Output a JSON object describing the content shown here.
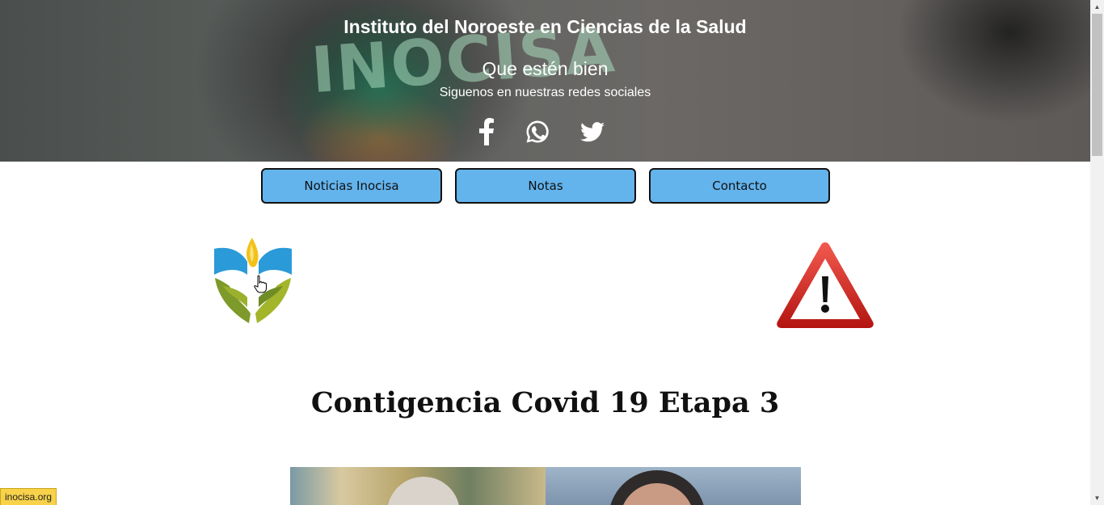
{
  "hero": {
    "title": "Instituto del Noroeste en Ciencias de la Salud",
    "subtitle": "Que estén bien",
    "follow_text": "Siguenos en nuestras redes sociales",
    "background_lettering": "INOCISA",
    "social": [
      {
        "name": "facebook",
        "icon": "facebook-icon"
      },
      {
        "name": "whatsapp",
        "icon": "whatsapp-icon"
      },
      {
        "name": "twitter",
        "icon": "twitter-icon"
      }
    ]
  },
  "nav": {
    "buttons": [
      {
        "label": "Noticias Inocisa"
      },
      {
        "label": "Notas"
      },
      {
        "label": "Contacto"
      }
    ],
    "button_color": "#63b3ec"
  },
  "main": {
    "logo_icon": "inocisa-logo-icon",
    "warning_icon": "warning-triangle-icon",
    "headline": "Contigencia Covid 19 Etapa 3"
  },
  "status_bar": {
    "url": "inocisa.org"
  }
}
